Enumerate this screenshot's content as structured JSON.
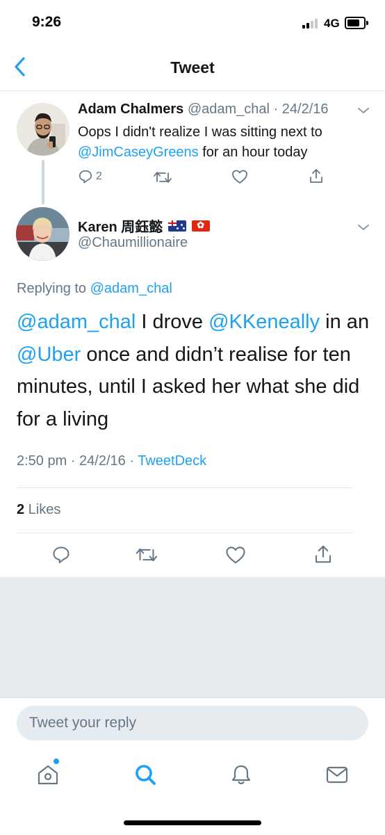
{
  "status_bar": {
    "time": "9:26",
    "network": "4G"
  },
  "nav": {
    "title": "Tweet",
    "back_icon": "chevron-left-icon"
  },
  "parent_tweet": {
    "name": "Adam Chalmers",
    "handle": "@adam_chal",
    "date": "· 24/2/16",
    "text_before": "Oops I didn't realize I was sitting next to ",
    "mention": "@JimCaseyGreens",
    "text_after": " for an hour today",
    "reply_count": "2"
  },
  "main_tweet": {
    "name": "Karen 周鈺懿",
    "flags": [
      "flag-australia-icon",
      "flag-hong-kong-icon"
    ],
    "handle": "@Chaumillionaire",
    "replying_label": "Replying to ",
    "replying_handle": "@adam_chal",
    "mention1": "@adam_chal",
    "text1": " I drove ",
    "mention2": "@KKeneally",
    "text2": " in an ",
    "mention3": "@Uber",
    "text3": " once and didn’t realise for ten minutes, until I asked her what she did for a living",
    "time": "2:50 pm",
    "date": "· 24/2/16 ·",
    "source": "TweetDeck",
    "likes_count": "2",
    "likes_label": " Likes"
  },
  "composer": {
    "placeholder": "Tweet your reply"
  },
  "colors": {
    "accent": "#1da1f2",
    "secondary_text": "#657786",
    "background_gray": "#e6ecf0"
  }
}
